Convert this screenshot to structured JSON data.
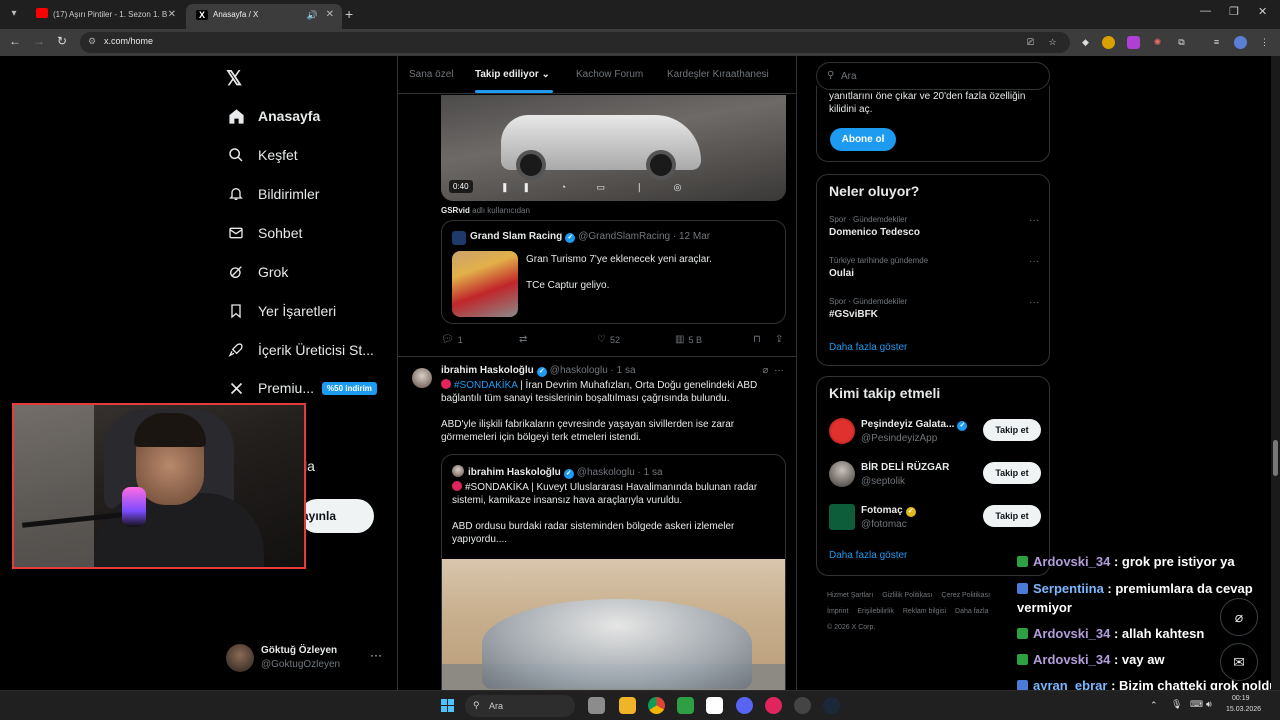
{
  "browser": {
    "tabs": [
      {
        "title": "(17) Aşırı Pintiler - 1. Sezon 1. B",
        "favicon": "youtube-icon"
      },
      {
        "title": "Anasayfa / X",
        "favicon": "x-icon"
      }
    ],
    "url": "x.com/home"
  },
  "nav": {
    "logo": "𝕏",
    "items": [
      {
        "label": "Anasayfa",
        "icon": "home-icon"
      },
      {
        "label": "Keşfet",
        "icon": "search-icon"
      },
      {
        "label": "Bildirimler",
        "icon": "bell-icon"
      },
      {
        "label": "Sohbet",
        "icon": "mail-icon"
      },
      {
        "label": "Grok",
        "icon": "grok-icon"
      },
      {
        "label": "Yer İşaretleri",
        "icon": "bookmark-icon"
      },
      {
        "label": "İçerik Üreticisi St...",
        "icon": "rocket-icon"
      },
      {
        "label": "Premiu...",
        "icon": "x-icon"
      }
    ],
    "premium_badge": "%50 indirim",
    "more_label": "zla",
    "post_label": "ayınla"
  },
  "profile": {
    "name": "Göktuğ Özleyen",
    "handle": "@GoktugOzleyen",
    "more": "···"
  },
  "feed": {
    "tabs": [
      "Sana özel",
      "Takip ediliyor",
      "Kachow Forum",
      "Kardeşler Kıraathanesi"
    ],
    "post1": {
      "video_time": "0:40",
      "from_user": "GSRvid",
      "from_suffix": "adlı kullanıcıdan",
      "quote": {
        "name": "Grand Slam Racing",
        "meta": "@GrandSlamRacing · 12 Mar",
        "text": "Gran Turismo 7'ye eklenecek yeni araçlar.\n\nTCe Captur geliyo."
      },
      "actions": {
        "replies": "1",
        "likes": "52",
        "views": "5 B"
      }
    },
    "post2": {
      "name": "ibrahim Haskoloğlu",
      "meta": "@haskologlu · 1 sa",
      "hashtag": "#SONDAKİKA",
      "text_after_hashtag": " | İran Devrim Muhafızları, Orta Doğu genelindeki ABD bağlantılı tüm sanayi tesislerinin boşaltılması çağrısında bulundu.\n\nABD'yle ilişkili fabrikaların çevresinde yaşayan sivillerden ise zarar görmemeleri için bölgeyi terk etmeleri istendi.",
      "quote": {
        "name": "ibrahim Haskoloğlu",
        "meta": "@haskologlu · 1 sa",
        "text": "#SONDAKİKA | Kuveyt Uluslararası Havalimanında bulunan radar sistemi, kamikaze insansız hava araçlarıyla vuruldu.\n\nABD ordusu burdaki radar sisteminden bölgede askeri izlemeler yapıyordu...."
      }
    }
  },
  "right": {
    "search_placeholder": "Ara",
    "premium_text": "yanıtlarını öne çıkar ve 20'den fazla özelliğin\nkilidini aç.",
    "subscribe_label": "Abone ol",
    "trends_title": "Neler oluyor?",
    "trends": [
      {
        "context": "Spor · Gündemdekiler",
        "name": "Domenico Tedesco"
      },
      {
        "context": "Türkiye tarihinde gündemde",
        "name": "Oulai"
      },
      {
        "context": "Spor · Gündemdekiler",
        "name": "#GSviBFK"
      }
    ],
    "show_more": "Daha fazla göster",
    "follow_title": "Kimi takip etmeli",
    "who": [
      {
        "name": "Peşindeyiz Galata...",
        "handle": "@PesindeyizApp",
        "btn": "Takip et"
      },
      {
        "name": "BİR DELİ RÜZGAR",
        "handle": "@septolik",
        "btn": "Takip et"
      },
      {
        "name": "Fotomaç",
        "handle": "@fotomac",
        "btn": "Takip et"
      }
    ],
    "footer": [
      "Hizmet Şartları",
      "Gizlilik Politikası",
      "Çerez Politikası",
      "İmprint",
      "Erişilebilirlik",
      "Reklam bilgisi",
      "Daha fazla",
      "© 2026 X Corp."
    ]
  },
  "chat": [
    {
      "user": "Ardovski_34",
      "msg": ": grok pre istiyor ya"
    },
    {
      "user": "Serpentiina",
      "msg": ": premiumlara da cevap vermiyor"
    },
    {
      "user": "Ardovski_34",
      "msg": ": allah kahtesn"
    },
    {
      "user": "Ardovski_34",
      "msg": ": vay aw"
    },
    {
      "user": "ayran_ebrar",
      "msg": ": Bizim chatteki grok noldu"
    }
  ],
  "taskbar": {
    "search_placeholder": "Ara",
    "time": "00:19",
    "date": "15.03.2026"
  },
  "colors": {
    "accent": "#1d9bf0",
    "background": "#000000",
    "border": "#2f3336"
  }
}
